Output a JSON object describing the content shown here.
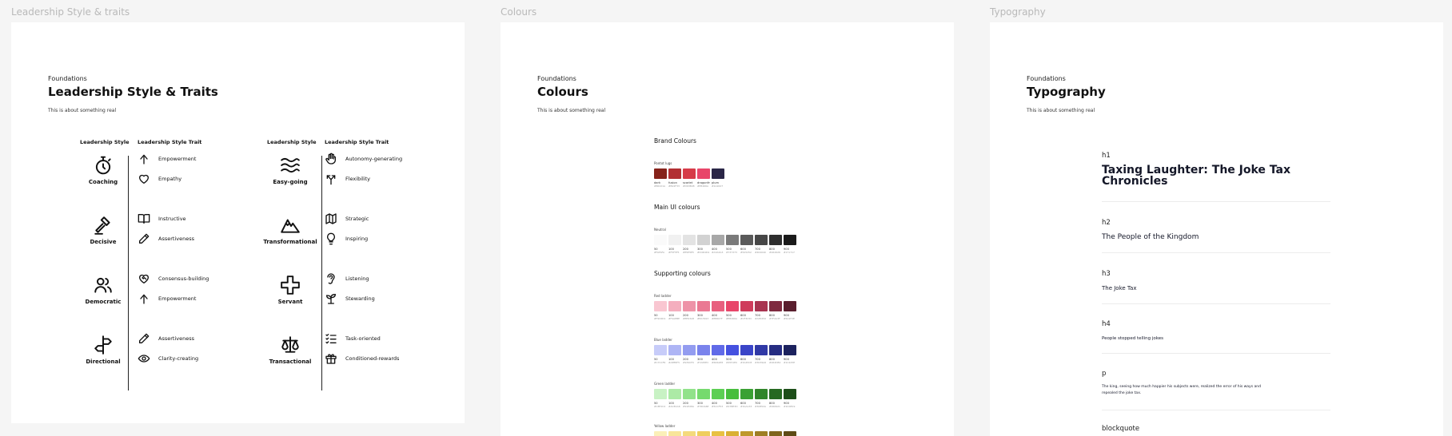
{
  "frames": {
    "leadership": {
      "label": "Leadership Style & traits",
      "eyebrow": "Foundations",
      "title": "Leadership Style & Traits",
      "description": "This is about something real",
      "headers": {
        "style": "Leadership Style",
        "trait": "Leadership Style Trait"
      },
      "groups": [
        {
          "style": "Coaching",
          "icon": "stopwatch-icon",
          "traits": [
            {
              "label": "Empowerment",
              "icon": "arrow-up-icon"
            },
            {
              "label": "Empathy",
              "icon": "heart-icon"
            }
          ]
        },
        {
          "style": "Decisive",
          "icon": "gavel-icon",
          "traits": [
            {
              "label": "Instructive",
              "icon": "book-open-icon"
            },
            {
              "label": "Assertiveness",
              "icon": "pencil-icon"
            }
          ]
        },
        {
          "style": "Democratic",
          "icon": "users-icon",
          "traits": [
            {
              "label": "Consensus-building",
              "icon": "heart-handshake-icon"
            },
            {
              "label": "Empowerment",
              "icon": "arrow-up-icon"
            }
          ]
        },
        {
          "style": "Directional",
          "icon": "directions-icon",
          "traits": [
            {
              "label": "Assertiveness",
              "icon": "pencil-icon"
            },
            {
              "label": "Clarity-creating",
              "icon": "eye-icon"
            }
          ]
        },
        {
          "style": "Easy-going",
          "icon": "waves-icon",
          "traits": [
            {
              "label": "Autonomy-generating",
              "icon": "hand-icon"
            },
            {
              "label": "Flexibility",
              "icon": "arrows-split-icon"
            }
          ]
        },
        {
          "style": "Transformational",
          "icon": "mountain-icon",
          "traits": [
            {
              "label": "Strategic",
              "icon": "map-icon"
            },
            {
              "label": "Inspiring",
              "icon": "lightbulb-icon"
            }
          ]
        },
        {
          "style": "Servant",
          "icon": "plus-icon",
          "traits": [
            {
              "label": "Listening",
              "icon": "ear-icon"
            },
            {
              "label": "Stewarding",
              "icon": "sprout-icon"
            }
          ]
        },
        {
          "style": "Transactional",
          "icon": "scale-icon",
          "traits": [
            {
              "label": "Task-oriented",
              "icon": "list-checks-icon"
            },
            {
              "label": "Conditioned-rewards",
              "icon": "gift-icon"
            }
          ]
        }
      ]
    },
    "colours": {
      "label": "Colours",
      "eyebrow": "Foundations",
      "title": "Colours",
      "description": "This is about something real",
      "brand": {
        "title": "Brand Colours",
        "palette_label": "Pontot lugs",
        "swatches": [
          {
            "name": "dark",
            "hex": "#86221A",
            "color": "#86221A"
          },
          {
            "name": "fusion",
            "hex": "#B22F33",
            "color": "#B22F33"
          },
          {
            "name": "scarlet",
            "hex": "#D63B48",
            "color": "#D63B48"
          },
          {
            "name": "dragonfruit",
            "hex": "#E8466A",
            "color": "#E8466A"
          },
          {
            "name": "plum",
            "hex": "#2A2647",
            "color": "#2A2647"
          }
        ]
      },
      "main": {
        "title": "Main UI colours",
        "palette_label": "Neutral",
        "swatches": [
          {
            "name": "50",
            "hex": "#FAFAFA",
            "color": "#FAFAFA"
          },
          {
            "name": "100",
            "hex": "#F5F5F5",
            "color": "#F1F1F1"
          },
          {
            "name": "200",
            "hex": "#E5E5E5",
            "color": "#E3E3E3"
          },
          {
            "name": "300",
            "hex": "#D4D4D4",
            "color": "#D2D2D2"
          },
          {
            "name": "400",
            "hex": "#A3A3A3",
            "color": "#A8A8A8"
          },
          {
            "name": "500",
            "hex": "#737373",
            "color": "#7A7A7A"
          },
          {
            "name": "600",
            "hex": "#525252",
            "color": "#5A5A5A"
          },
          {
            "name": "700",
            "hex": "#404040",
            "color": "#474747"
          },
          {
            "name": "800",
            "hex": "#262626",
            "color": "#2E2E2E"
          },
          {
            "name": "900",
            "hex": "#171717",
            "color": "#1A1A1A"
          }
        ]
      },
      "supporting": {
        "title": "Supporting colours",
        "palettes": [
          {
            "label": "Red ladder",
            "swatches": [
              {
                "name": "50",
                "hex": "#F9C6D1",
                "color": "#F9C6D1"
              },
              {
                "name": "100",
                "hex": "#F4AEBE",
                "color": "#F4AEBE"
              },
              {
                "name": "200",
                "hex": "#EE93A8",
                "color": "#EE93A8"
              },
              {
                "name": "300",
                "hex": "#EA7993",
                "color": "#EA7993"
              },
              {
                "name": "400",
                "hex": "#E8607F",
                "color": "#E8607F"
              },
              {
                "name": "500",
                "hex": "#E8466A",
                "color": "#E8466A"
              },
              {
                "name": "600",
                "hex": "#CF3C5C",
                "color": "#CF3C5C"
              },
              {
                "name": "700",
                "hex": "#A83450",
                "color": "#A83450"
              },
              {
                "name": "800",
                "hex": "#7F2A3F",
                "color": "#7F2A3F"
              },
              {
                "name": "900",
                "hex": "#5A1F2E",
                "color": "#5A1F2E"
              }
            ]
          },
          {
            "label": "Blue ladder",
            "swatches": [
              {
                "name": "50",
                "hex": "#C7CCF9",
                "color": "#C7CCF9"
              },
              {
                "name": "100",
                "hex": "#AEB5F5",
                "color": "#AEB5F5"
              },
              {
                "name": "200",
                "hex": "#939CF0",
                "color": "#939CF0"
              },
              {
                "name": "300",
                "hex": "#7A83EC",
                "color": "#7A83EC"
              },
              {
                "name": "400",
                "hex": "#606AE8",
                "color": "#606AE8"
              },
              {
                "name": "500",
                "hex": "#4551E0",
                "color": "#4551E0"
              },
              {
                "name": "600",
                "hex": "#3A45C8",
                "color": "#3A45C8"
              },
              {
                "name": "700",
                "hex": "#3039A6",
                "color": "#3039A6"
              },
              {
                "name": "800",
                "hex": "#262D82",
                "color": "#262D82"
              },
              {
                "name": "900",
                "hex": "#1C225E",
                "color": "#1C225E"
              }
            ]
          },
          {
            "label": "Green ladder",
            "swatches": [
              {
                "name": "50",
                "hex": "#C8F2C4",
                "color": "#C8F2C4"
              },
              {
                "name": "100",
                "hex": "#ACEAA6",
                "color": "#ACEAA6"
              },
              {
                "name": "200",
                "hex": "#91E28A",
                "color": "#91E28A"
              },
              {
                "name": "300",
                "hex": "#76DA6E",
                "color": "#76DA6E"
              },
              {
                "name": "400",
                "hex": "#5CCF53",
                "color": "#5CCF53"
              },
              {
                "name": "500",
                "hex": "#47BE3D",
                "color": "#47BE3D"
              },
              {
                "name": "600",
                "hex": "#3AA133",
                "color": "#3AA133"
              },
              {
                "name": "700",
                "hex": "#30852A",
                "color": "#30852A"
              },
              {
                "name": "800",
                "hex": "#266921",
                "color": "#266921"
              },
              {
                "name": "900",
                "hex": "#1D4E19",
                "color": "#1D4E19"
              }
            ]
          },
          {
            "label": "Yellow ladder",
            "swatches": [
              {
                "name": "50",
                "hex": "#FBEFB8",
                "color": "#FBEFB8"
              },
              {
                "name": "100",
                "hex": "#F8E59A",
                "color": "#F8E59A"
              },
              {
                "name": "200",
                "hex": "#F4DA7C",
                "color": "#F4DA7C"
              },
              {
                "name": "300",
                "hex": "#EFCE5E",
                "color": "#EFCE5E"
              },
              {
                "name": "400",
                "hex": "#E8C142",
                "color": "#E8C142"
              },
              {
                "name": "500",
                "hex": "#D9B034",
                "color": "#D9B034"
              },
              {
                "name": "600",
                "hex": "#BE982B",
                "color": "#BE982B"
              },
              {
                "name": "700",
                "hex": "#9E7E24",
                "color": "#9E7E24"
              },
              {
                "name": "800",
                "hex": "#7E641D",
                "color": "#7E641D"
              },
              {
                "name": "900",
                "hex": "#5E4B16",
                "color": "#5E4B16"
              }
            ]
          }
        ]
      }
    },
    "typography": {
      "label": "Typography",
      "eyebrow": "Foundations",
      "title": "Typography",
      "description": "This is about something real",
      "items": [
        {
          "tag": "h1",
          "sample": "Taxing Laughter: The Joke Tax Chronicles"
        },
        {
          "tag": "h2",
          "sample": "The People of the Kingdom"
        },
        {
          "tag": "h3",
          "sample": "The Joke Tax"
        },
        {
          "tag": "h4",
          "sample": "People stopped telling jokes"
        },
        {
          "tag": "p",
          "sample": "The king, seeing how much happier his subjects were, realized the error of his ways and repealed the joke tax."
        },
        {
          "tag": "blockquote",
          "sample": ""
        }
      ]
    }
  }
}
